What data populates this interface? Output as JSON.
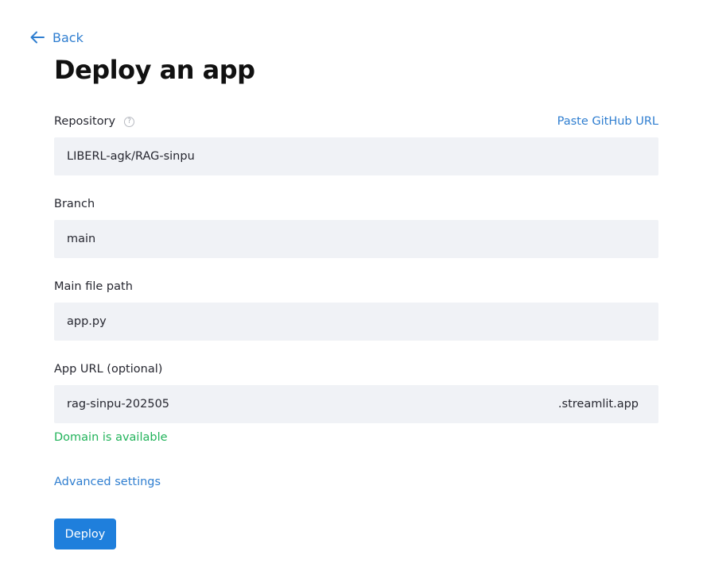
{
  "nav": {
    "back_label": "Back"
  },
  "page": {
    "title": "Deploy an app"
  },
  "repository": {
    "label": "Repository",
    "help_icon": "question-circle-icon",
    "paste_link": "Paste GitHub URL",
    "value": "LIBERL-agk/RAG-sinpu"
  },
  "branch": {
    "label": "Branch",
    "value": "main"
  },
  "main_file": {
    "label": "Main file path",
    "value": "app.py"
  },
  "app_url": {
    "label": "App URL (optional)",
    "value": "rag-sinpu-202505",
    "suffix": ".streamlit.app",
    "status": "Domain is available"
  },
  "advanced": {
    "label": "Advanced settings"
  },
  "actions": {
    "deploy_label": "Deploy"
  },
  "colors": {
    "link": "#2f7ed0",
    "success": "#21b35a",
    "primary_button": "#1f7fdc",
    "field_background": "#f0f2f6"
  }
}
